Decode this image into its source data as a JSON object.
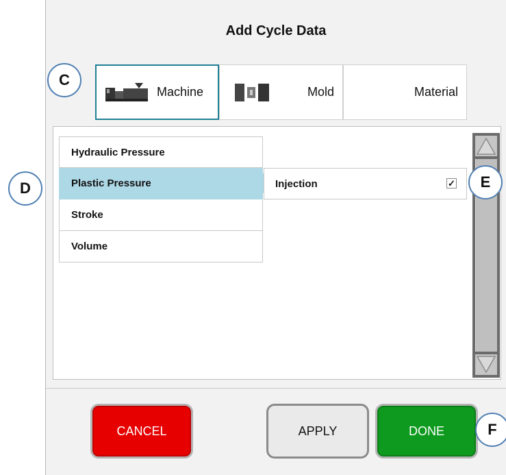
{
  "dialog": {
    "title": "Add Cycle Data"
  },
  "tabs": [
    {
      "label": "Machine",
      "icon": "machine-icon",
      "active": true
    },
    {
      "label": "Mold",
      "icon": "mold-icon",
      "active": false
    },
    {
      "label": "Material",
      "active": false
    }
  ],
  "list": {
    "items": [
      {
        "label": "Hydraulic Pressure"
      },
      {
        "label": "Plastic Pressure",
        "selected": true
      },
      {
        "label": "Stroke"
      },
      {
        "label": "Volume"
      }
    ]
  },
  "sublist": {
    "items": [
      {
        "label": "Injection",
        "checked": true,
        "check_glyph": "✓"
      }
    ]
  },
  "buttons": {
    "cancel": "CANCEL",
    "apply": "APPLY",
    "done": "DONE"
  },
  "callouts": {
    "c": "C",
    "d": "D",
    "e": "E",
    "f": "F"
  },
  "colors": {
    "accent": "#1f7f95",
    "selected": "#add8e6",
    "cancel": "#e60000",
    "done": "#0e9a1e",
    "callout_border": "#4f7fb2"
  }
}
